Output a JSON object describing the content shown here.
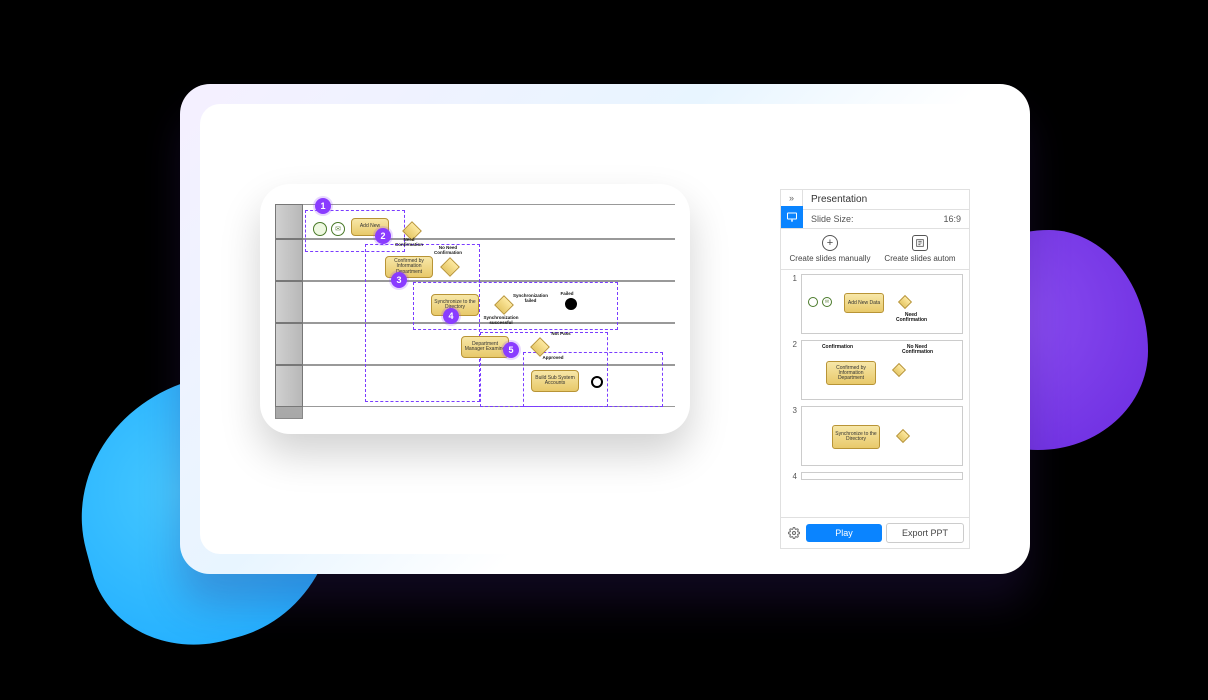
{
  "diagram": {
    "tasks": {
      "add_new": "Add New",
      "confirmed": "Confirmed by Information Department",
      "sync": "Synchronize to the Directory",
      "examine": "Department Manager Examine",
      "build": "Build Sub System Accounts"
    },
    "labels": {
      "need_conf": "Need Confirmation",
      "no_need_conf": "No Need Confirmation",
      "sync_fail": "Synchronization failed",
      "sync_success": "Synchronization successful",
      "failed": "Failed",
      "not_pass": "Not Pass",
      "approved": "Approved",
      "confirmation": "Confirmation"
    },
    "badges": [
      "1",
      "2",
      "3",
      "4",
      "5"
    ]
  },
  "presentation": {
    "title": "Presentation",
    "size_label": "Slide Size:",
    "size_value": "16:9",
    "create_manual": "Create slides manually",
    "create_auto": "Create slides autom",
    "slides": [
      {
        "num": "1",
        "task": "Add New Data",
        "extra": "Need Confirmation"
      },
      {
        "num": "2",
        "task": "Confirmed by Information Department",
        "top": "Confirmation",
        "right": "No Need Confirmation"
      },
      {
        "num": "3",
        "task": "Synchronize to the Directory"
      },
      {
        "num": "4",
        "task": ""
      }
    ],
    "play": "Play",
    "export": "Export PPT"
  }
}
